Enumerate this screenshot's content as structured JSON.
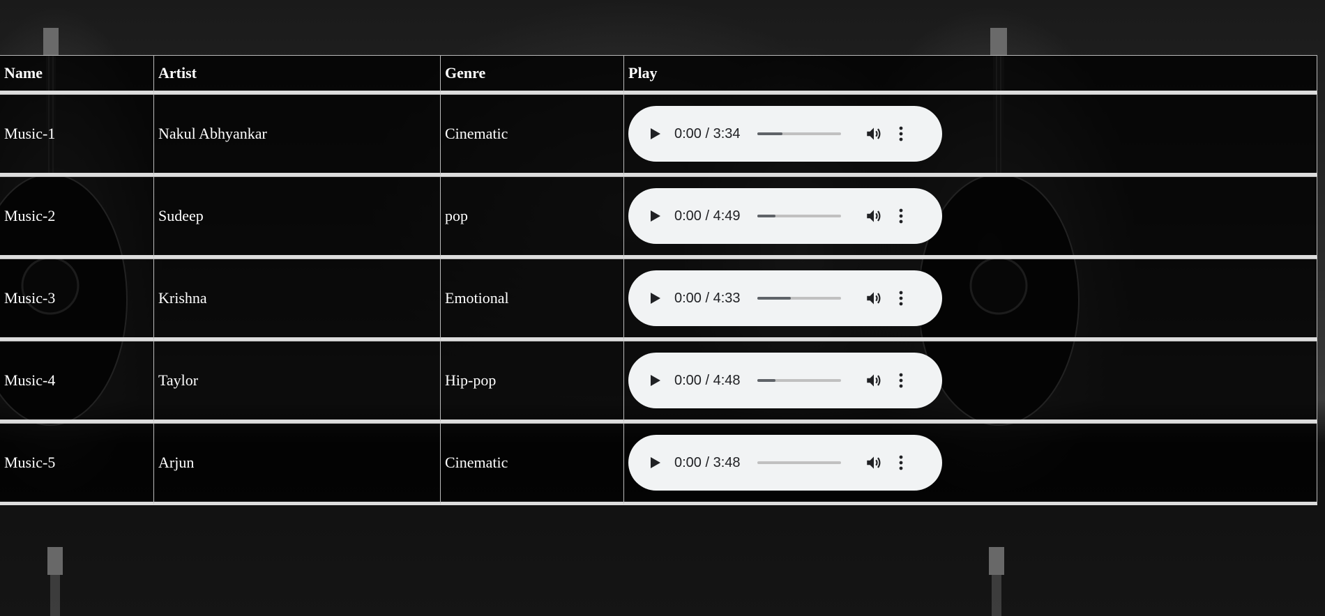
{
  "table": {
    "headers": [
      "Name",
      "Artist",
      "Genre",
      "Play"
    ],
    "rows": [
      {
        "name": "Music-1",
        "artist": "Nakul Abhyankar",
        "genre": "Cinematic",
        "time": "0:00 / 3:34",
        "buffered": 0.3
      },
      {
        "name": "Music-2",
        "artist": "Sudeep",
        "genre": "pop",
        "time": "0:00 / 4:49",
        "buffered": 0.22
      },
      {
        "name": "Music-3",
        "artist": "Krishna",
        "genre": "Emotional",
        "time": "0:00 / 4:33",
        "buffered": 0.4
      },
      {
        "name": "Music-4",
        "artist": "Taylor",
        "genre": "Hip-pop",
        "time": "0:00 / 4:48",
        "buffered": 0.22
      },
      {
        "name": "Music-5",
        "artist": "Arjun",
        "genre": "Cinematic",
        "time": "0:00 / 3:48",
        "buffered": 0.0
      }
    ]
  },
  "icons": {
    "play": "play-icon",
    "volume": "volume-icon",
    "more": "more-options-icon"
  },
  "colors": {
    "player_bg": "#f1f3f4",
    "progress_track": "#c0c0c0",
    "progress_fill": "#5f6368"
  }
}
